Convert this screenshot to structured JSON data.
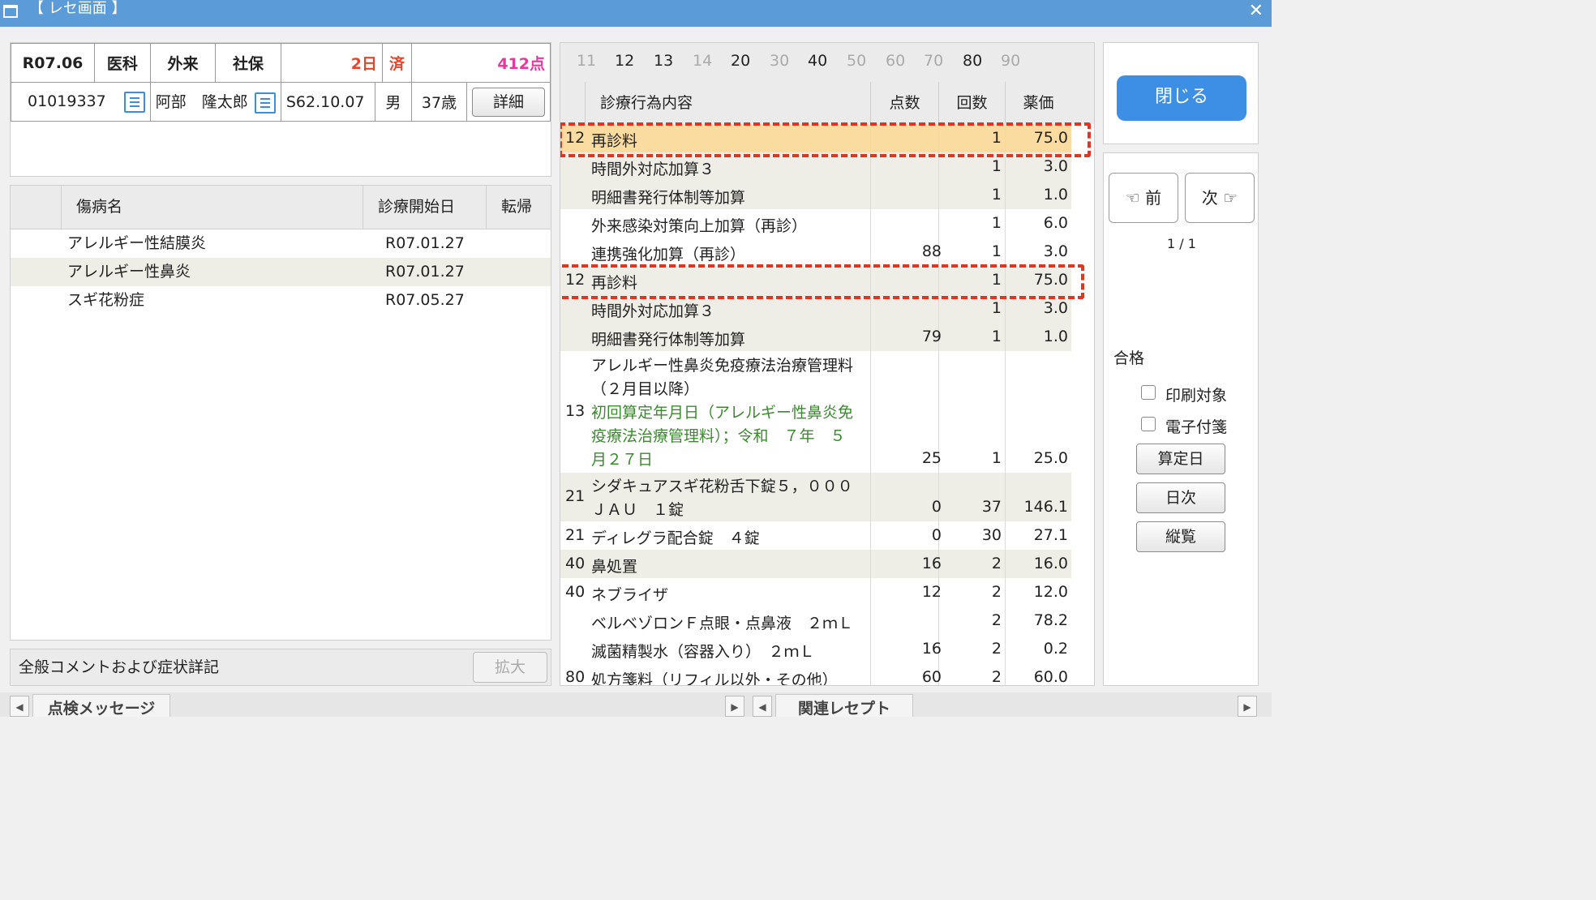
{
  "window": {
    "title": "【 レセ画面 】",
    "close_label": "✕"
  },
  "patient": {
    "period": "R07.06",
    "dept": "医科",
    "visit_type": "外来",
    "insurance": "社保",
    "days": "2日",
    "status": "済",
    "points": "412点",
    "id": "01019337",
    "name": "阿部　隆太郎",
    "birth": "S62.10.07",
    "sex": "男",
    "age": "37歳",
    "detail_label": "詳細"
  },
  "disease": {
    "headers": [
      "傷病名",
      "診療開始日",
      "転帰"
    ],
    "rows": [
      {
        "name": "アレルギー性結膜炎",
        "date": "R07.01.27",
        "outcome": ""
      },
      {
        "name": "アレルギー性鼻炎",
        "date": "R07.01.27",
        "outcome": ""
      },
      {
        "name": "スギ花粉症",
        "date": "R07.05.27",
        "outcome": ""
      }
    ]
  },
  "comment": {
    "label": "全般コメントおよび症状詳記",
    "expand_label": "拡大"
  },
  "treatment": {
    "tabs": [
      {
        "label": "11",
        "active": false
      },
      {
        "label": "12",
        "active": true
      },
      {
        "label": "13",
        "active": true
      },
      {
        "label": "14",
        "active": false
      },
      {
        "label": "20",
        "active": true
      },
      {
        "label": "30",
        "active": false
      },
      {
        "label": "40",
        "active": true
      },
      {
        "label": "50",
        "active": false
      },
      {
        "label": "60",
        "active": false
      },
      {
        "label": "70",
        "active": false
      },
      {
        "label": "80",
        "active": true
      },
      {
        "label": "90",
        "active": false
      }
    ],
    "headers": {
      "content": "診療行為内容",
      "points": "点数",
      "count": "回数",
      "price": "薬価"
    },
    "rows": [
      {
        "code": "12",
        "lines": [
          "再診料"
        ],
        "points": "",
        "count": "1",
        "price": "75.0"
      },
      {
        "code": "",
        "lines": [
          "時間外対応加算３"
        ],
        "points": "",
        "count": "1",
        "price": "3.0"
      },
      {
        "code": "",
        "lines": [
          "明細書発行体制等加算"
        ],
        "points": "",
        "count": "1",
        "price": "1.0"
      },
      {
        "code": "",
        "lines": [
          "外来感染対策向上加算（再診）"
        ],
        "points": "",
        "count": "1",
        "price": "6.0"
      },
      {
        "code": "",
        "lines": [
          "連携強化加算（再診）"
        ],
        "points": "88",
        "count": "1",
        "price": "3.0"
      },
      {
        "code": "12",
        "lines": [
          "再診料"
        ],
        "points": "",
        "count": "1",
        "price": "75.0"
      },
      {
        "code": "",
        "lines": [
          "時間外対応加算３"
        ],
        "points": "",
        "count": "1",
        "price": "3.0"
      },
      {
        "code": "",
        "lines": [
          "明細書発行体制等加算"
        ],
        "points": "79",
        "count": "1",
        "price": "1.0"
      },
      {
        "code": "13",
        "lines": [
          "アレルギー性鼻炎免疫療法治療管理料",
          "（２月目以降）"
        ],
        "green_lines": [
          "初回算定年月日（アレルギー性鼻炎免",
          "疫療法治療管理料）；令和　７年　５",
          "月２７日"
        ],
        "points": "25",
        "count": "1",
        "price": "25.0"
      },
      {
        "code": "21",
        "lines": [
          "シダキュアスギ花粉舌下錠５，０００",
          "ＪＡＵ　１錠"
        ],
        "points": "0",
        "count": "37",
        "price": "146.1"
      },
      {
        "code": "21",
        "lines": [
          "ディレグラ配合錠　４錠"
        ],
        "points": "0",
        "count": "30",
        "price": "27.1"
      },
      {
        "code": "40",
        "lines": [
          "鼻処置"
        ],
        "points": "16",
        "count": "2",
        "price": "16.0"
      },
      {
        "code": "40",
        "lines": [
          "ネブライザ"
        ],
        "points": "12",
        "count": "2",
        "price": "12.0"
      },
      {
        "code": "",
        "lines": [
          "ベルベゾロンＦ点眼・点鼻液　２ｍＬ"
        ],
        "points": "",
        "count": "2",
        "price": "78.2"
      },
      {
        "code": "",
        "lines": [
          "滅菌精製水（容器入り）　２ｍＬ"
        ],
        "points": "16",
        "count": "2",
        "price": "0.2"
      },
      {
        "code": "80",
        "lines": [
          "処方箋料（リフィル以外・その他）"
        ],
        "points": "60",
        "count": "2",
        "price": "60.0"
      }
    ]
  },
  "side": {
    "close_label": "閉じる",
    "prev_label": "☜ 前",
    "next_label": "次 ☞",
    "page": "1 / 1",
    "result": "合格",
    "print_label": "印刷対象",
    "attach_label": "電子付箋",
    "calc_date_label": "算定日",
    "daily_label": "日次",
    "vertical_label": "縦覧"
  },
  "bottom": {
    "check_tab": "点検メッセージ",
    "related_tab": "関連レセプト"
  }
}
